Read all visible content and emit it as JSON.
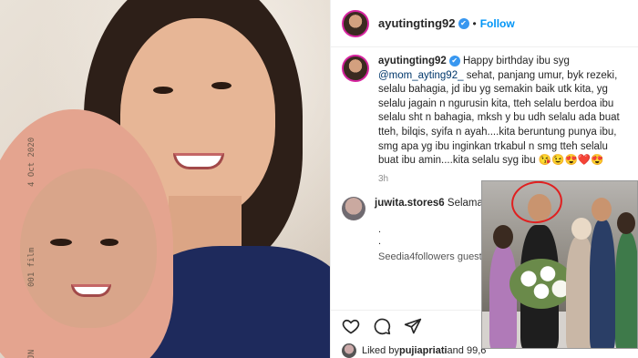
{
  "photo": {
    "film_date": "4 Oct 2020",
    "film_label": "001 film",
    "film_tag": "KJN"
  },
  "post": {
    "username": "ayutingting92",
    "follow_label": "Follow",
    "dot": "•",
    "caption_user": "ayutingting92",
    "caption_prefix": "Happy birthday ibu syg ",
    "caption_mention": "@mom_ayting92_",
    "caption_body": " sehat, panjang umur, byk rezeki, selalu bahagia, jd ibu yg semakin baik utk kita, yg selalu jagain n ngurusin kita, tteh selalu berdoa ibu selalu sht n bahagia, mksh y bu udh selalu ada buat tteh, bilqis, syifa n ayah....kita beruntung punya ibu, smg apa yg ibu inginkan trkabul n smg tteh selalu buat ibu amin....kita selalu syg ibu",
    "caption_emojis": "😘😉😍❤️😍",
    "time": "3h",
    "comment_user": "juwita.stores6",
    "comment_text": " Selamat u tahun mom 😍😍😍😍",
    "dots": ".\n.",
    "next_comment": "Seedia4followers guest",
    "liked_prefix": "Liked by ",
    "liked_user": "pujiapriati",
    "liked_suffix": " and 99,6"
  },
  "icons": [
    "heart-icon",
    "comment-icon",
    "share-icon"
  ],
  "colors": {
    "follow": "#0095f6",
    "verified": "#3897f0",
    "mention": "#00376b"
  }
}
